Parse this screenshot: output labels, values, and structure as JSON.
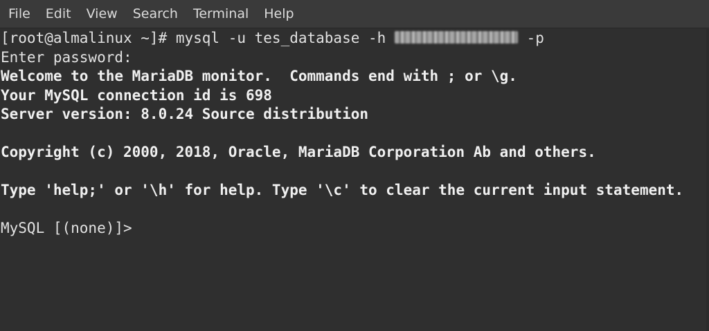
{
  "menu": {
    "items": [
      "File",
      "Edit",
      "View",
      "Search",
      "Terminal",
      "Help"
    ]
  },
  "terminal": {
    "command_prefix": "[root@almalinux ~]# mysql -u tes_database -h ",
    "command_suffix": " -p",
    "lines": [
      "Enter password:",
      "Welcome to the MariaDB monitor.  Commands end with ; or \\g.",
      "Your MySQL connection id is 698",
      "Server version: 8.0.24 Source distribution",
      "",
      "Copyright (c) 2000, 2018, Oracle, MariaDB Corporation Ab and others.",
      "",
      "Type 'help;' or '\\h' for help. Type '\\c' to clear the current input statement.",
      "",
      "MySQL [(none)]>"
    ]
  },
  "colors": {
    "background": "#2f2f2f",
    "menubar": "#3a3a3a",
    "text": "#e2e2e2"
  }
}
